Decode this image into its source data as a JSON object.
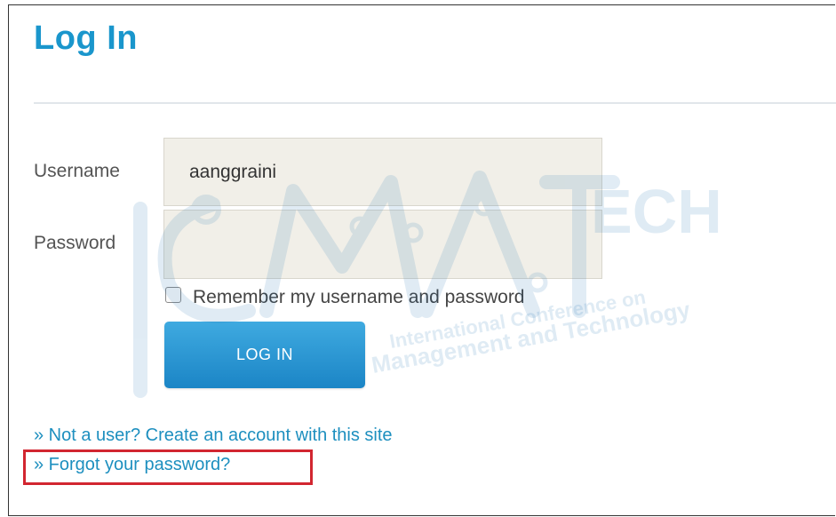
{
  "page": {
    "title": "Log In"
  },
  "form": {
    "username_label": "Username",
    "username_value": "aanggraini",
    "password_label": "Password",
    "password_value": "",
    "remember_label": "Remember my username and password",
    "remember_checked": false,
    "login_button": "LOG IN"
  },
  "links": {
    "create_account": "» Not a user? Create an account with this site",
    "forgot_password": "» Forgot your password?"
  },
  "watermark": {
    "brand": "ICMATECH",
    "line1": "International Conference on",
    "line2": "Management and Technology"
  },
  "colors": {
    "accent": "#1a96cc",
    "button": "#2a9ad6",
    "highlight": "#d22630"
  }
}
